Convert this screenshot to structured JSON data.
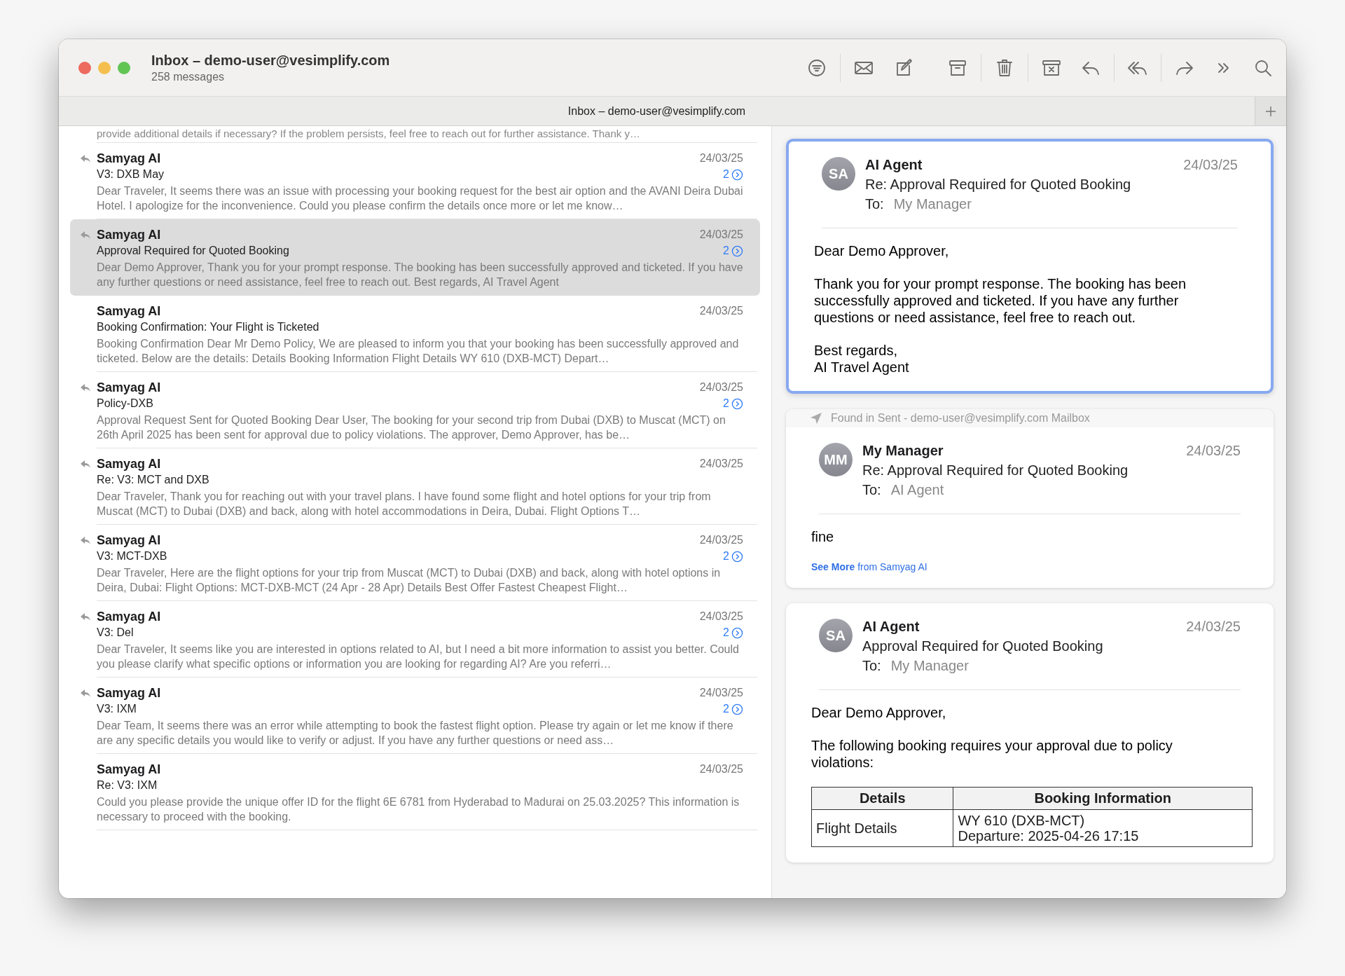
{
  "window": {
    "title": "Inbox – demo-user@vesimplify.com",
    "subtitle": "258 messages"
  },
  "tab": {
    "label": "Inbox – demo-user@vesimplify.com"
  },
  "list_top_fragment": "provide additional details if necessary? If the problem persists, feel free to reach out for further assistance. Thank y…",
  "messages": [
    {
      "sender": "Samyag AI",
      "date": "24/03/25",
      "subject": "V3: DXB May",
      "preview": "Dear Traveler, It seems there was an issue with processing your booking request for the best air option and the AVANI Deira Dubai Hotel. I apologize for the inconvenience. Could you please confirm the details once more or let me know…",
      "replied": true,
      "thread_count": "2",
      "selected": false
    },
    {
      "sender": "Samyag AI",
      "date": "24/03/25",
      "subject": "Approval Required for Quoted Booking",
      "preview": "Dear Demo Approver, Thank you for your prompt response. The booking has been successfully approved and ticketed. If you have any further questions or need assistance, feel free to reach out. Best regards, AI Travel Agent",
      "replied": true,
      "thread_count": "2",
      "selected": true
    },
    {
      "sender": "Samyag AI",
      "date": "24/03/25",
      "subject": "Booking Confirmation: Your Flight is Ticketed",
      "preview": "Booking Confirmation Dear Mr Demo Policy, We are pleased to inform you that your booking has been successfully approved and ticketed. Below are the details: Details Booking Information Flight Details WY 610 (DXB-MCT) Depart…",
      "replied": false,
      "selected": false
    },
    {
      "sender": "Samyag AI",
      "date": "24/03/25",
      "subject": "Policy-DXB",
      "preview": "Approval Request Sent for Quoted Booking Dear User, The booking for your second trip from Dubai (DXB) to Muscat (MCT) on 26th April 2025 has been sent for approval due to policy violations. The approver, Demo Approver, has be…",
      "replied": true,
      "thread_count": "2",
      "selected": false
    },
    {
      "sender": "Samyag AI",
      "date": "24/03/25",
      "subject": "Re: V3: MCT and DXB",
      "preview": "Dear Traveler, Thank you for reaching out with your travel plans. I have found some flight and hotel options for your trip from Muscat (MCT) to Dubai (DXB) and back, along with hotel accommodations in Deira, Dubai. Flight Options T…",
      "replied": true,
      "selected": false
    },
    {
      "sender": "Samyag AI",
      "date": "24/03/25",
      "subject": "V3: MCT-DXB",
      "preview": "Dear Traveler, Here are the flight options for your trip from Muscat (MCT) to Dubai (DXB) and back, along with hotel options in Deira, Dubai: Flight Options: MCT-DXB-MCT (24 Apr - 28 Apr) Details Best Offer Fastest Cheapest Flight…",
      "replied": true,
      "thread_count": "2",
      "selected": false
    },
    {
      "sender": "Samyag AI",
      "date": "24/03/25",
      "subject": "V3: Del",
      "preview": "Dear Traveler, It seems like you are interested in options related to AI, but I need a bit more information to assist you better. Could you please clarify what specific options or information you are looking for regarding AI? Are you referri…",
      "replied": true,
      "thread_count": "2",
      "selected": false
    },
    {
      "sender": "Samyag AI",
      "date": "24/03/25",
      "subject": "V3: IXM",
      "preview": "Dear Team, It seems there was an error while attempting to book the fastest flight option. Please try again or let me know if there are any specific details you would like to verify or adjust. If you have any further questions or need ass…",
      "replied": true,
      "thread_count": "2",
      "selected": false
    },
    {
      "sender": "Samyag AI",
      "date": "24/03/25",
      "subject": "Re: V3: IXM",
      "preview": "Could you please provide the unique offer ID for the flight 6E 6781 from Hyderabad to Madurai on 25.03.2025? This information is necessary to proceed with the booking.",
      "replied": false,
      "selected": false
    }
  ],
  "conversation": [
    {
      "initials": "SA",
      "sender": "AI Agent",
      "date": "24/03/25",
      "subject": "Re: Approval Required for Quoted Booking",
      "to_label": "To:",
      "to": "My Manager",
      "selected": true,
      "body": [
        "Dear Demo Approver,",
        "Thank you for your prompt response. The booking has been successfully approved and ticketed. If you have any further questions or need assistance, feel free to reach out.",
        "Best regards,\nAI Travel Agent"
      ]
    },
    {
      "found_in": "Found in Sent - demo-user@vesimplify.com Mailbox",
      "initials": "MM",
      "sender": "My Manager",
      "date": "24/03/25",
      "subject": "Re: Approval Required for Quoted Booking",
      "to_label": "To:",
      "to": "AI Agent",
      "selected": false,
      "body": [
        "fine"
      ],
      "see_more": "**See More** from Samyag AI"
    },
    {
      "initials": "SA",
      "sender": "AI Agent",
      "date": "24/03/25",
      "subject": "Approval Required for Quoted Booking",
      "to_label": "To:",
      "to": "My Manager",
      "selected": false,
      "body": [
        "Dear Demo Approver,",
        "The following booking requires your approval due to policy violations:"
      ],
      "table": {
        "columns": [
          "Details",
          "Booking Information"
        ],
        "rows": [
          [
            "Flight Details",
            "WY 610 (DXB-MCT)\nDeparture: 2025-04-26 17:15"
          ]
        ]
      }
    }
  ]
}
